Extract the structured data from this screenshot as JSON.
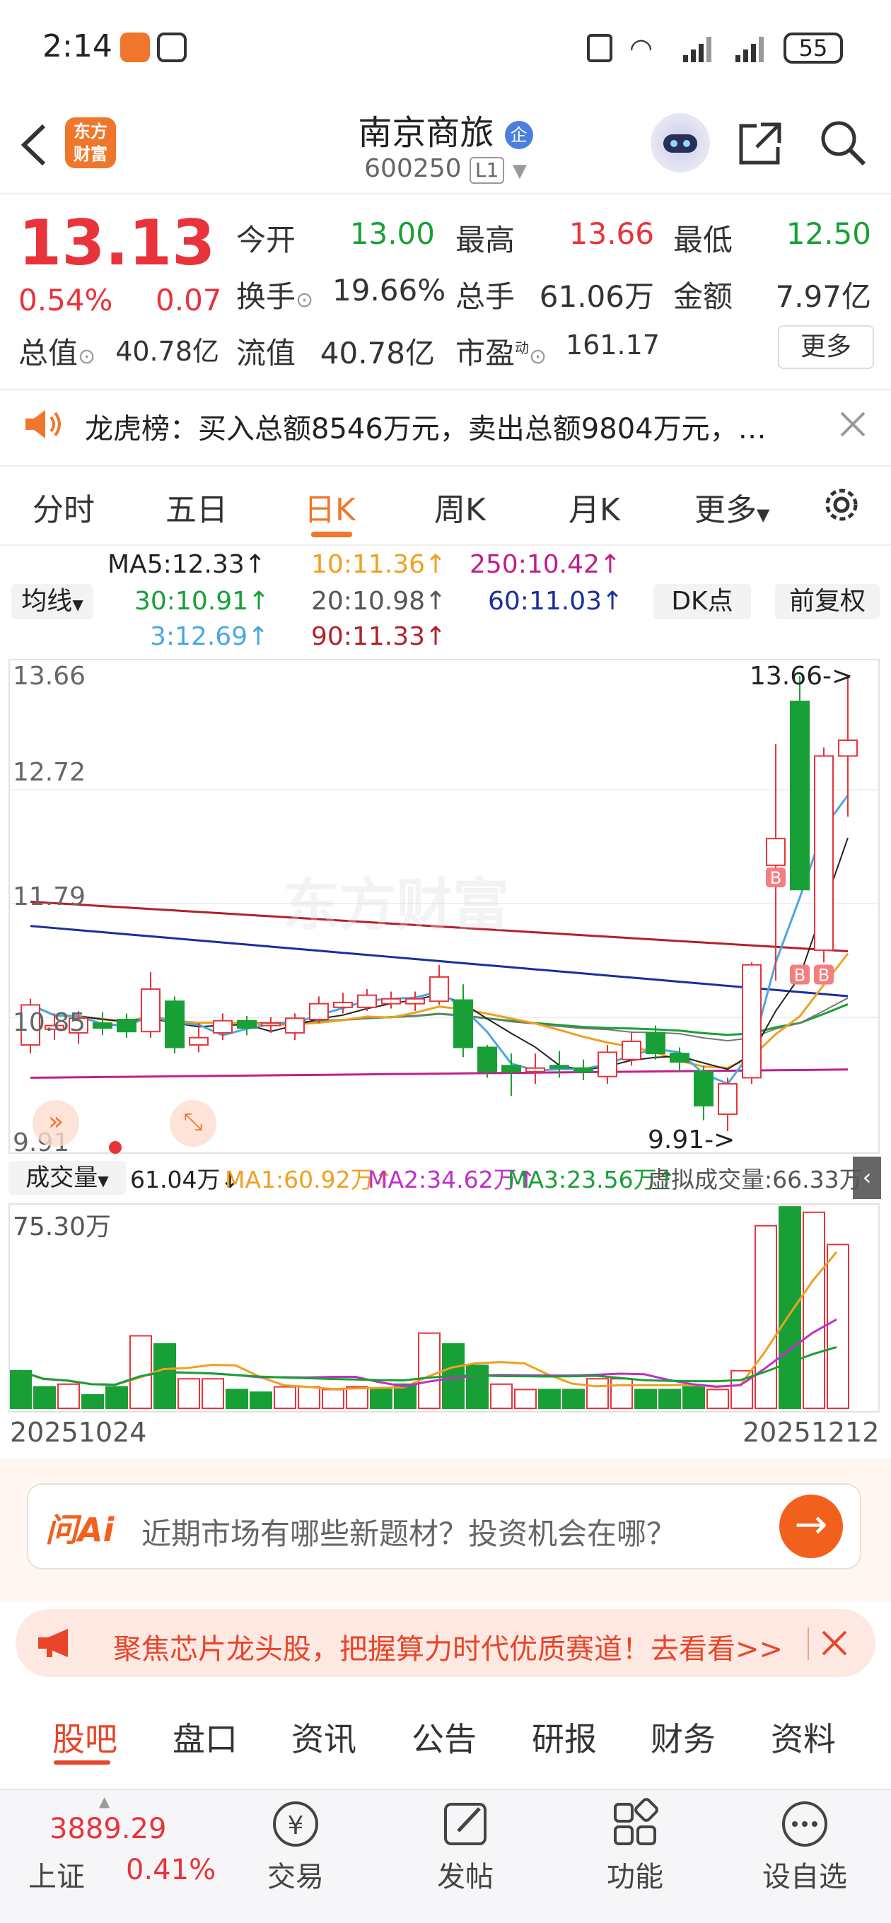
{
  "status_bar": {
    "time": "2:14",
    "battery": "55"
  },
  "header": {
    "title": "南京商旅",
    "badge": "企",
    "code": "600250",
    "level": "L1",
    "logo_line1": "东方",
    "logo_line2": "财富"
  },
  "quote": {
    "price": "13.13",
    "change_pct": "0.54%",
    "change": "0.07",
    "open_label": "今开",
    "open": "13.00",
    "high_label": "最高",
    "high": "13.66",
    "low_label": "最低",
    "low": "12.50",
    "turnover_label": "换手",
    "turnover": "19.66%",
    "volume_label": "总手",
    "volume": "61.06万",
    "amount_label": "金额",
    "amount": "7.97亿",
    "mktcap_label": "总值",
    "mktcap": "40.78亿",
    "float_label": "流值",
    "float_cap": "40.78亿",
    "pe_label": "市盈",
    "pe_sup": "动",
    "pe": "161.17",
    "more_label": "更多"
  },
  "notice": {
    "text": "龙虎榜：买入总额8546万元，卖出总额9804万元，…"
  },
  "kline_tabs": [
    "分时",
    "五日",
    "日K",
    "周K",
    "月K",
    "更多"
  ],
  "ma_panel": {
    "select_label": "均线",
    "ma5": "MA5:12.33↑",
    "ma10": "10:11.36↑",
    "ma250": "250:10.42↑",
    "ma30": "30:10.91↑",
    "ma20": "20:10.98↑",
    "ma60": "60:11.03↑",
    "ma3": "3:12.69↑",
    "ma90": "90:11.33↑",
    "dk_label": "DK点",
    "adjust_label": "前复权"
  },
  "price_axis": {
    "top": "13.66",
    "l2": "12.72",
    "l3": "11.79",
    "l4": "10.85",
    "bottom": "9.91"
  },
  "annotations": {
    "high_mark": "13.66->",
    "low_mark": "9.91->",
    "watermark": "东方财富",
    "buy_marker": "B"
  },
  "volume": {
    "select_label": "成交量",
    "current": "61.04万↓",
    "ma1": "MA1:60.92万↑",
    "ma2": "MA2:34.62万↑",
    "ma3": "MA3:23.56万↑",
    "virtual": "虚拟成交量:66.33万",
    "axis_max": "75.30万"
  },
  "dates": {
    "start": "20251024",
    "end": "20251212"
  },
  "ai": {
    "logo": "问Ai",
    "placeholder": "近期市场有哪些新题材？投资机会在哪？"
  },
  "promo": {
    "text": "聚焦芯片龙头股，把握算力时代优质赛道！去看看>>"
  },
  "bottom_tabs": [
    "股吧",
    "盘口",
    "资讯",
    "公告",
    "研报",
    "财务",
    "资料"
  ],
  "nav": {
    "index_value": "3889.29",
    "index_name": "上证",
    "index_change": "0.41%",
    "items": [
      "交易",
      "发帖",
      "功能",
      "设自选"
    ]
  },
  "colors": {
    "up": "#e8333b",
    "down": "#18a036",
    "accent": "#f0762b"
  },
  "chart_data": {
    "type": "candlestick",
    "ylim": [
      9.91,
      13.66
    ],
    "candles": [
      {
        "o": 10.62,
        "c": 10.95,
        "h": 11.0,
        "l": 10.55
      },
      {
        "o": 10.75,
        "c": 10.78,
        "h": 10.88,
        "l": 10.66
      },
      {
        "o": 10.72,
        "c": 10.84,
        "h": 10.9,
        "l": 10.63
      },
      {
        "o": 10.8,
        "c": 10.76,
        "h": 10.89,
        "l": 10.7
      },
      {
        "o": 10.83,
        "c": 10.73,
        "h": 10.88,
        "l": 10.68
      },
      {
        "o": 10.73,
        "c": 11.08,
        "h": 11.22,
        "l": 10.68
      },
      {
        "o": 10.98,
        "c": 10.6,
        "h": 11.02,
        "l": 10.55
      },
      {
        "o": 10.62,
        "c": 10.68,
        "h": 10.8,
        "l": 10.56
      },
      {
        "o": 10.72,
        "c": 10.82,
        "h": 10.88,
        "l": 10.66
      },
      {
        "o": 10.82,
        "c": 10.76,
        "h": 10.86,
        "l": 10.7
      },
      {
        "o": 10.78,
        "c": 10.8,
        "h": 10.85,
        "l": 10.72
      },
      {
        "o": 10.72,
        "c": 10.84,
        "h": 10.88,
        "l": 10.66
      },
      {
        "o": 10.83,
        "c": 10.96,
        "h": 11.02,
        "l": 10.8
      },
      {
        "o": 10.93,
        "c": 10.97,
        "h": 11.05,
        "l": 10.88
      },
      {
        "o": 10.93,
        "c": 11.03,
        "h": 11.08,
        "l": 10.9
      },
      {
        "o": 10.96,
        "c": 11.0,
        "h": 11.06,
        "l": 10.92
      },
      {
        "o": 10.96,
        "c": 11.0,
        "h": 11.06,
        "l": 10.9
      },
      {
        "o": 10.98,
        "c": 11.18,
        "h": 11.28,
        "l": 10.95
      },
      {
        "o": 10.99,
        "c": 10.6,
        "h": 11.12,
        "l": 10.52
      },
      {
        "o": 10.6,
        "c": 10.4,
        "h": 10.62,
        "l": 10.35
      },
      {
        "o": 10.45,
        "c": 10.4,
        "h": 10.55,
        "l": 10.2
      },
      {
        "o": 10.4,
        "c": 10.43,
        "h": 10.55,
        "l": 10.3
      },
      {
        "o": 10.45,
        "c": 10.43,
        "h": 10.57,
        "l": 10.35
      },
      {
        "o": 10.43,
        "c": 10.4,
        "h": 10.5,
        "l": 10.33
      },
      {
        "o": 10.36,
        "c": 10.56,
        "h": 10.62,
        "l": 10.3
      },
      {
        "o": 10.5,
        "c": 10.65,
        "h": 10.72,
        "l": 10.45
      },
      {
        "o": 10.72,
        "c": 10.55,
        "h": 10.78,
        "l": 10.5
      },
      {
        "o": 10.55,
        "c": 10.48,
        "h": 10.6,
        "l": 10.4
      },
      {
        "o": 10.4,
        "c": 10.12,
        "h": 10.45,
        "l": 10.0
      },
      {
        "o": 10.05,
        "c": 10.3,
        "h": 10.35,
        "l": 9.91
      },
      {
        "o": 10.35,
        "c": 11.28,
        "h": 11.3,
        "l": 10.3
      },
      {
        "o": 12.1,
        "c": 12.32,
        "h": 13.1,
        "l": 11.15
      },
      {
        "o": 13.45,
        "c": 11.9,
        "h": 13.66,
        "l": 11.9
      },
      {
        "o": 11.4,
        "c": 13.0,
        "h": 13.07,
        "l": 11.3
      },
      {
        "o": 13.0,
        "c": 13.13,
        "h": 13.66,
        "l": 12.5
      }
    ],
    "volume_ylim": [
      0,
      75.3
    ],
    "volumes": [
      {
        "v": 14,
        "up": false
      },
      {
        "v": 8,
        "up": false
      },
      {
        "v": 9,
        "up": true
      },
      {
        "v": 5,
        "up": false
      },
      {
        "v": 8,
        "up": false
      },
      {
        "v": 27,
        "up": true
      },
      {
        "v": 24,
        "up": false
      },
      {
        "v": 11,
        "up": true
      },
      {
        "v": 11,
        "up": true
      },
      {
        "v": 7,
        "up": false
      },
      {
        "v": 6,
        "up": false
      },
      {
        "v": 8,
        "up": true
      },
      {
        "v": 8,
        "up": true
      },
      {
        "v": 7,
        "up": true
      },
      {
        "v": 8,
        "up": true
      },
      {
        "v": 7,
        "up": false
      },
      {
        "v": 9,
        "up": false
      },
      {
        "v": 28,
        "up": true
      },
      {
        "v": 24,
        "up": false
      },
      {
        "v": 16,
        "up": false
      },
      {
        "v": 9,
        "up": true
      },
      {
        "v": 7,
        "up": true
      },
      {
        "v": 7,
        "up": false
      },
      {
        "v": 7,
        "up": false
      },
      {
        "v": 11,
        "up": true
      },
      {
        "v": 11,
        "up": true
      },
      {
        "v": 7,
        "up": false
      },
      {
        "v": 7,
        "up": false
      },
      {
        "v": 8,
        "up": false
      },
      {
        "v": 7,
        "up": true
      },
      {
        "v": 14,
        "up": true
      },
      {
        "v": 68,
        "up": true
      },
      {
        "v": 75,
        "up": false
      },
      {
        "v": 73,
        "up": true
      },
      {
        "v": 61,
        "up": true
      }
    ]
  }
}
